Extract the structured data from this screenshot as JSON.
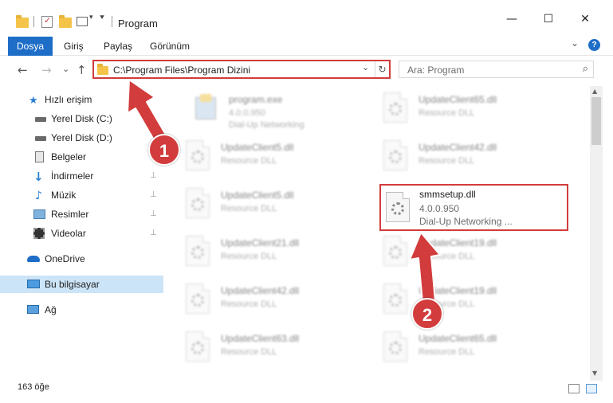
{
  "window": {
    "title": "Program",
    "minimize_glyph": "—",
    "maximize_glyph": "☐",
    "close_glyph": "✕",
    "help_glyph": "?",
    "collapse_glyph": "⌄"
  },
  "ribbon": {
    "tabs": [
      "Dosya",
      "Giriş",
      "Paylaş",
      "Görünüm"
    ]
  },
  "address": {
    "path": "C:\\Program Files\\Program Dizini",
    "dropdown_glyph": "⌄",
    "refresh_glyph": "↻"
  },
  "nav": {
    "back": "←",
    "forward": "→",
    "recent": "⌄",
    "up": "↑"
  },
  "search": {
    "placeholder": "Ara: Program",
    "icon": "⌕"
  },
  "sidebar": {
    "items": [
      {
        "label": "Hızlı erişim",
        "icon": "star-icon",
        "pinned": false
      },
      {
        "label": "Yerel Disk (C:)",
        "icon": "drive-icon",
        "pinned": true
      },
      {
        "label": "Yerel Disk (D:)",
        "icon": "drive-icon",
        "pinned": true
      },
      {
        "label": "Belgeler",
        "icon": "documents-icon",
        "pinned": true
      },
      {
        "label": "İndirmeler",
        "icon": "download-icon",
        "pinned": true
      },
      {
        "label": "Müzik",
        "icon": "music-icon",
        "pinned": true
      },
      {
        "label": "Resimler",
        "icon": "pictures-icon",
        "pinned": true
      },
      {
        "label": "Videolar",
        "icon": "video-icon",
        "pinned": true
      },
      {
        "label": "OneDrive",
        "icon": "cloud-icon",
        "pinned": false
      },
      {
        "label": "Bu bilgisayar",
        "icon": "computer-icon",
        "pinned": false,
        "selected": true
      },
      {
        "label": "Ağ",
        "icon": "network-icon",
        "pinned": false
      }
    ],
    "pin_glyph": "📌"
  },
  "files": [
    {
      "name": "program.exe",
      "sub": "4.0.0.950",
      "sub2": "Dial-Up Networking"
    },
    {
      "name": "UpdateClient65.dll",
      "sub": "Resource DLL"
    },
    {
      "name": "UpdateClient5.dll",
      "sub": "Resource DLL"
    },
    {
      "name": "UpdateClient42.dll",
      "sub": "Resource DLL"
    },
    {
      "name": "UpdateClient5.dll",
      "sub": "Resource DLL"
    },
    {
      "name": "UpdateClient21.dll",
      "sub": "Resource DLL"
    },
    {
      "name": "UpdateClient19.dll",
      "sub": "Resource DLL"
    },
    {
      "name": "UpdateClient42.dll",
      "sub": "Resource DLL"
    },
    {
      "name": "UpdateClient19.dll",
      "sub": "Resource DLL"
    },
    {
      "name": "UpdateClient63.dll",
      "sub": "Resource DLL"
    },
    {
      "name": "UpdateClient65.dll",
      "sub": "Resource DLL"
    }
  ],
  "highlighted_file": {
    "name": "smmsetup.dll",
    "version": "4.0.0.950",
    "description": "Dial-Up Networking ..."
  },
  "status": {
    "count": "163 öğe"
  },
  "annotations": [
    {
      "number": "1",
      "color": "#d23c3c"
    },
    {
      "number": "2",
      "color": "#d23c3c"
    }
  ],
  "colors": {
    "accent": "#1e6ec8",
    "highlight": "#d23c3c",
    "selected_bg": "#cce4f7"
  }
}
